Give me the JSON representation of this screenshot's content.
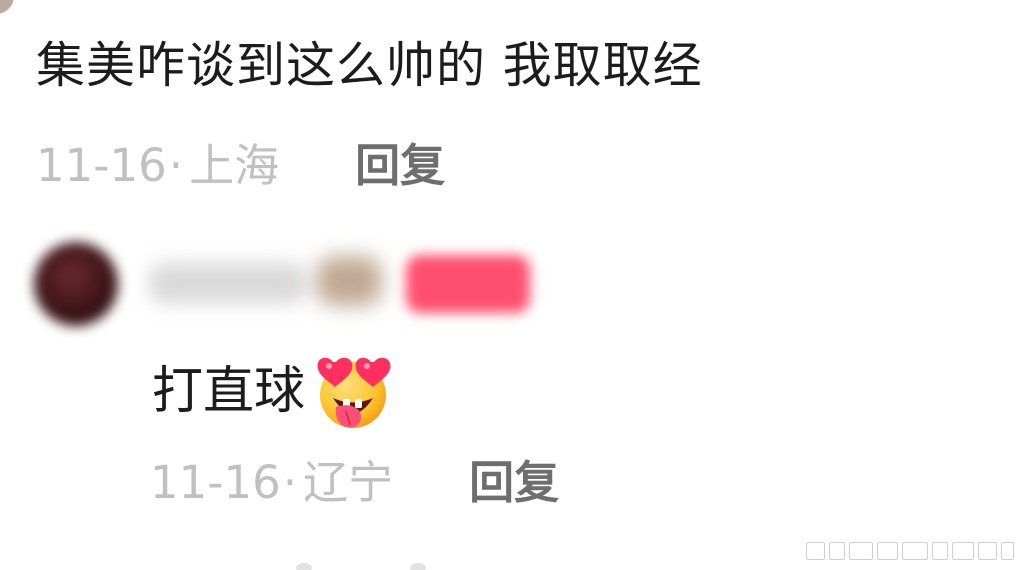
{
  "comment": {
    "text": "集美咋谈到这么帅的 我取取经",
    "date": "11-16",
    "separator": "·",
    "location": "上海",
    "reply_label": "回复"
  },
  "reply": {
    "text": "打直球",
    "emoji": "heart-eyes-tongue-emoji",
    "date": "11-16",
    "separator": "·",
    "location": "辽宁",
    "reply_label": "回复"
  },
  "colors": {
    "text": "#1c1c1c",
    "meta": "#c0c0c0",
    "reply_link": "#6e6e6e",
    "badge": "#ff4f6e",
    "background": "#ffffff"
  },
  "icons": {
    "watermark": "weibo-watermark-icon"
  }
}
